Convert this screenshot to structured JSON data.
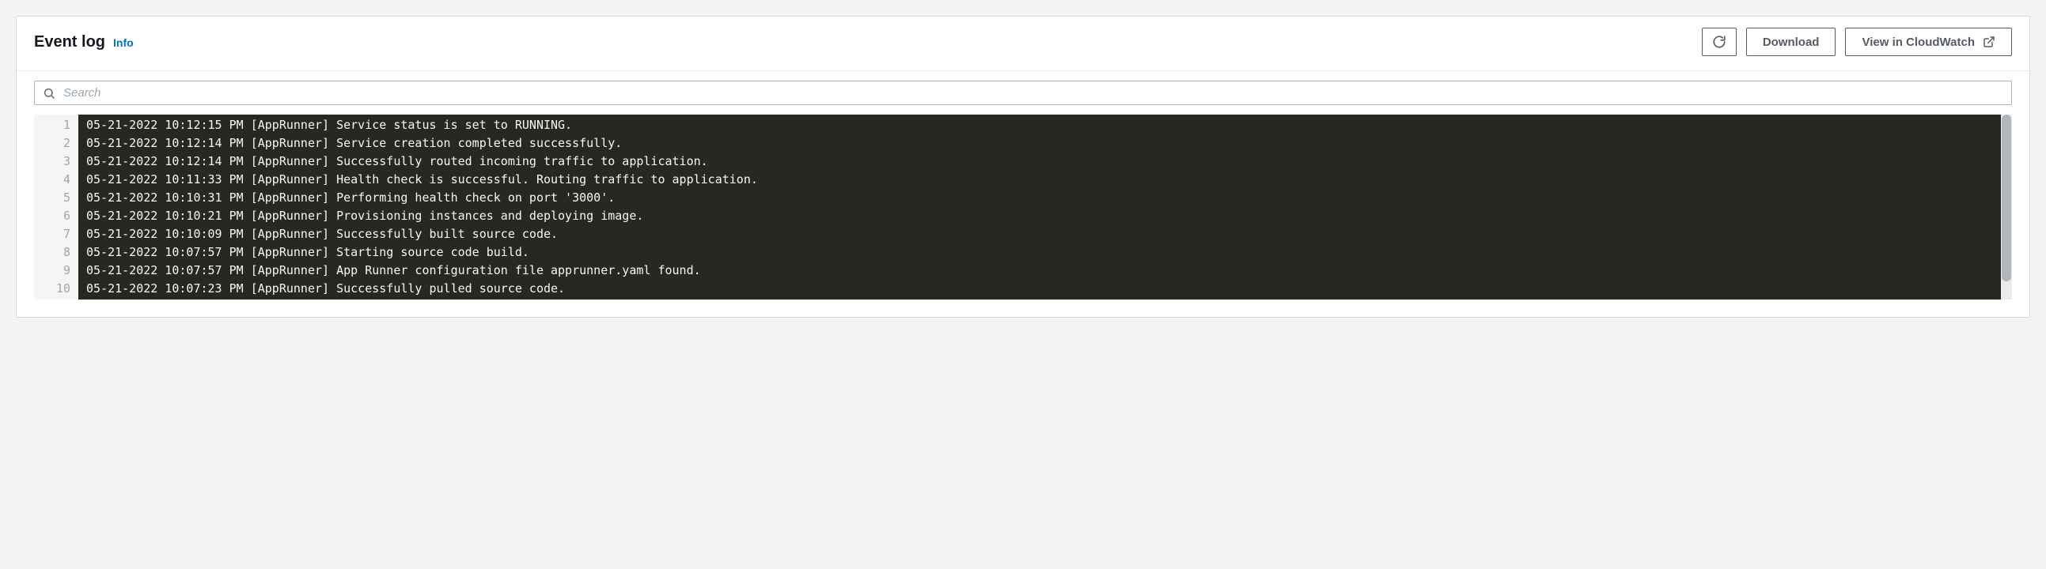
{
  "header": {
    "title": "Event log",
    "info_label": "Info"
  },
  "buttons": {
    "download": "Download",
    "view_cloudwatch": "View in CloudWatch"
  },
  "search": {
    "placeholder": "Search",
    "value": ""
  },
  "log": {
    "lines": [
      "05-21-2022 10:12:15 PM [AppRunner] Service status is set to RUNNING.",
      "05-21-2022 10:12:14 PM [AppRunner] Service creation completed successfully.",
      "05-21-2022 10:12:14 PM [AppRunner] Successfully routed incoming traffic to application.",
      "05-21-2022 10:11:33 PM [AppRunner] Health check is successful. Routing traffic to application.",
      "05-21-2022 10:10:31 PM [AppRunner] Performing health check on port '3000'.",
      "05-21-2022 10:10:21 PM [AppRunner] Provisioning instances and deploying image.",
      "05-21-2022 10:10:09 PM [AppRunner] Successfully built source code.",
      "05-21-2022 10:07:57 PM [AppRunner] Starting source code build.",
      "05-21-2022 10:07:57 PM [AppRunner] App Runner configuration file apprunner.yaml found.",
      "05-21-2022 10:07:23 PM [AppRunner] Successfully pulled source code."
    ]
  }
}
